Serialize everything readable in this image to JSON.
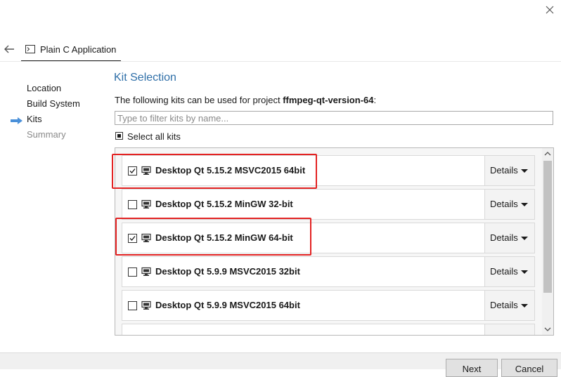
{
  "window": {
    "close_icon": "close-icon"
  },
  "header": {
    "back_icon": "back-arrow-icon",
    "tab_label": "Plain C Application",
    "tab_icon": "terminal-icon"
  },
  "sidebar": {
    "steps": [
      {
        "label": "Location",
        "state": "done"
      },
      {
        "label": "Build System",
        "state": "done"
      },
      {
        "label": "Kits",
        "state": "current"
      },
      {
        "label": "Summary",
        "state": "pending"
      }
    ],
    "current_indicator_icon": "arrow-right-icon"
  },
  "main": {
    "title": "Kit Selection",
    "intro_prefix": "The following kits can be used for project ",
    "project_name": "ffmpeg-qt-version-64",
    "intro_suffix": ":",
    "filter_placeholder": "Type to filter kits by name...",
    "filter_value": "",
    "select_all_label": "Select all kits",
    "select_all_state": "partial",
    "kits": [
      {
        "name": "Desktop Qt 5.15.2 MSVC2015 64bit",
        "checked": true,
        "details_label": "Details",
        "highlighted": true
      },
      {
        "name": "Desktop Qt 5.15.2 MinGW 32-bit",
        "checked": false,
        "details_label": "Details",
        "highlighted": false
      },
      {
        "name": "Desktop Qt 5.15.2 MinGW 64-bit",
        "checked": true,
        "details_label": "Details",
        "highlighted": true
      },
      {
        "name": "Desktop Qt 5.9.9 MSVC2015 32bit",
        "checked": false,
        "details_label": "Details",
        "highlighted": false
      },
      {
        "name": "Desktop Qt 5.9.9 MSVC2015 64bit",
        "checked": false,
        "details_label": "Details",
        "highlighted": false
      }
    ]
  },
  "footer": {
    "next_label": "Next",
    "cancel_label": "Cancel"
  },
  "colors": {
    "accent_title": "#2f6fa8",
    "highlight": "#e32222",
    "arrow": "#4a90d9"
  }
}
